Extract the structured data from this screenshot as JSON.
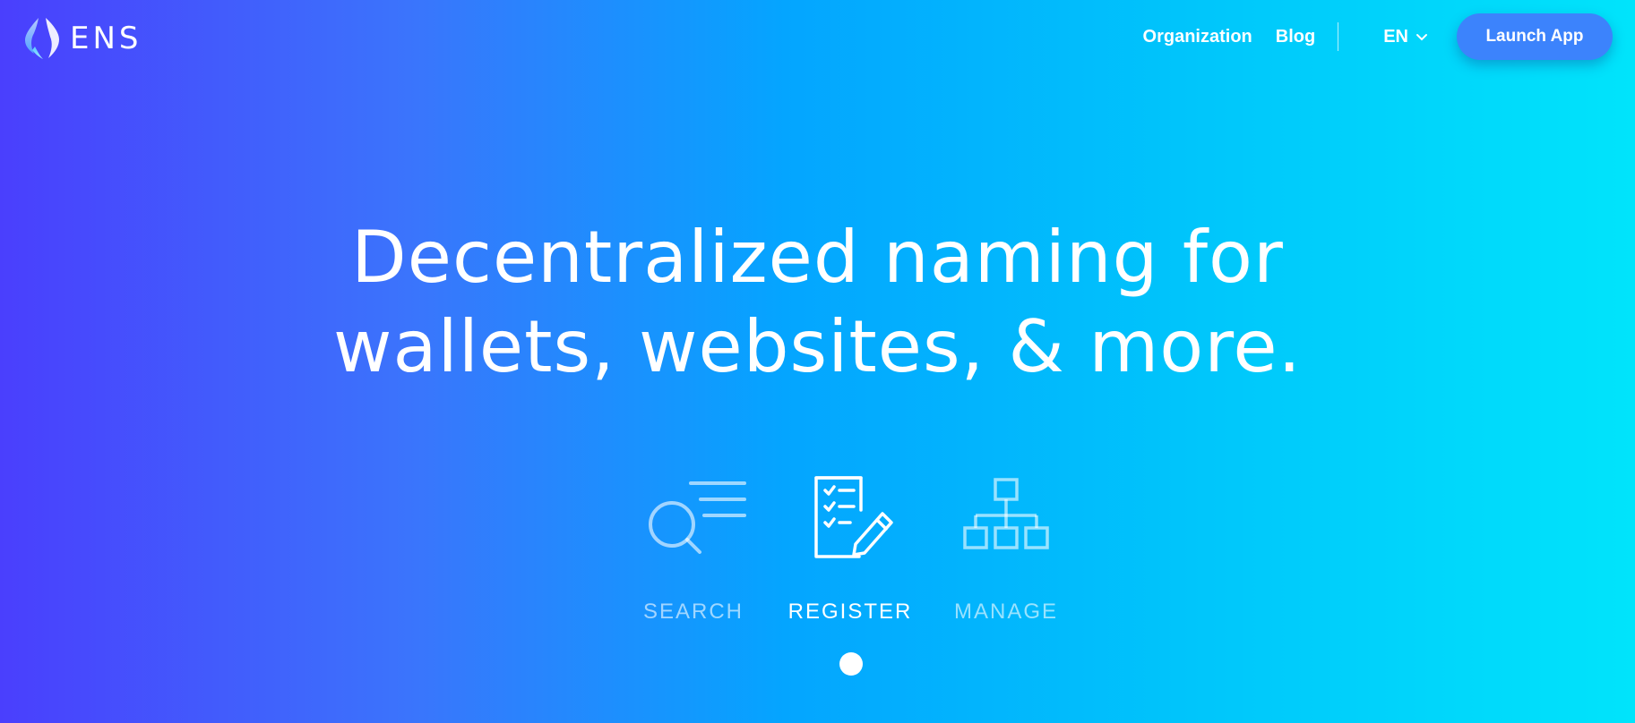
{
  "header": {
    "logo_text": "ENS",
    "nav": {
      "organization": "Organization",
      "blog": "Blog",
      "language": "EN",
      "launch_button": "Launch App"
    }
  },
  "hero": {
    "headline_line1": "Decentralized naming for",
    "headline_line2": "wallets, websites, & more."
  },
  "steps": [
    {
      "label": "SEARCH",
      "icon": "search-list-icon",
      "active": false
    },
    {
      "label": "REGISTER",
      "icon": "checklist-pencil-icon",
      "active": true
    },
    {
      "label": "MANAGE",
      "icon": "hierarchy-icon",
      "active": false
    }
  ],
  "carousel": {
    "active_index": 1
  },
  "colors": {
    "gradient_start": "#4a3ffd",
    "gradient_mid": "#04a5ff",
    "gradient_end": "#00e4fb",
    "button_bg": "#3c83fc"
  }
}
